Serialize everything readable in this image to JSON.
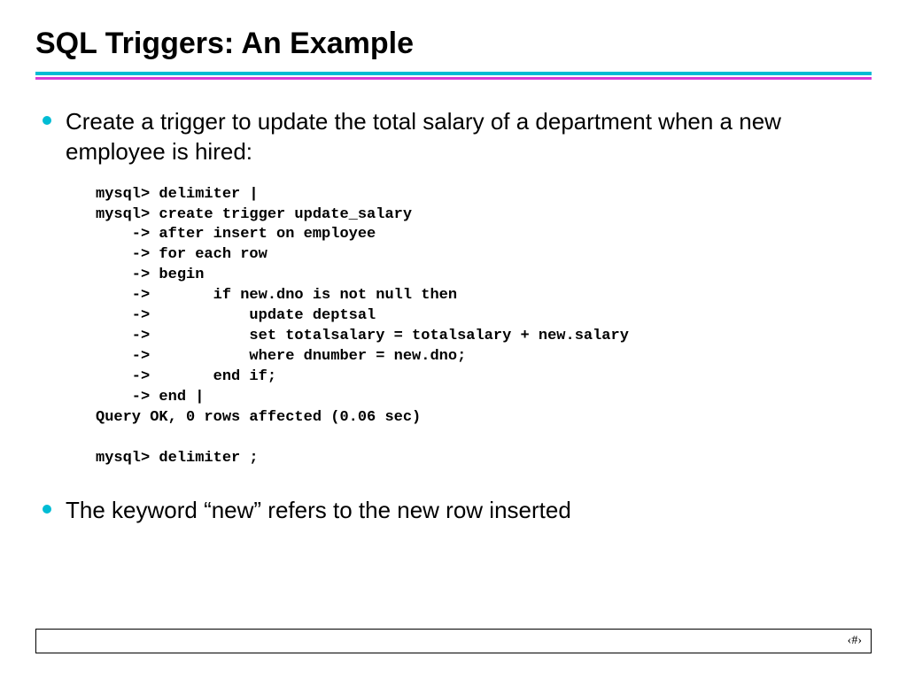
{
  "title": "SQL Triggers: An Example",
  "bullets": {
    "item1": "Create a trigger to update the total salary of a department when a new employee is hired:",
    "item2": "The keyword “new” refers to the new row inserted"
  },
  "code": "mysql> delimiter |\nmysql> create trigger update_salary\n    -> after insert on employee\n    -> for each row\n    -> begin\n    ->       if new.dno is not null then\n    ->           update deptsal\n    ->           set totalsalary = totalsalary + new.salary\n    ->           where dnumber = new.dno;\n    ->       end if;\n    -> end |\nQuery OK, 0 rows affected (0.06 sec)\n\nmysql> delimiter ;",
  "footer": {
    "page_marker": "‹#›"
  }
}
